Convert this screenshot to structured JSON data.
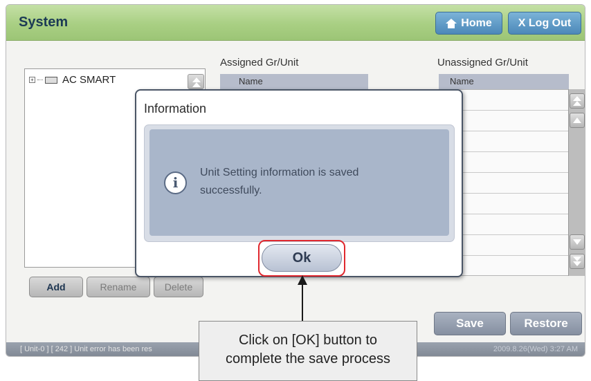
{
  "window": {
    "title": "System",
    "home_label": "Home",
    "logout_label": "X Log Out"
  },
  "tree": {
    "root_label": "AC SMART",
    "expand_symbol": "+"
  },
  "tree_buttons": {
    "add": "Add",
    "rename": "Rename",
    "delete": "Delete"
  },
  "assigned": {
    "title": "Assigned Gr/Unit",
    "column_header": "Name"
  },
  "unassigned": {
    "title": "Unassigned Gr/Unit",
    "column_header": "Name"
  },
  "actions": {
    "save": "Save",
    "restore": "Restore"
  },
  "statusbar": {
    "message": "[ Unit-0 ] [ 242 ] Unit error has been res",
    "datetime": "2009.8.26(Wed)  3:27 AM"
  },
  "dialog": {
    "title": "Information",
    "icon": "info-icon",
    "icon_glyph": "i",
    "message": "Unit Setting information is saved successfully.",
    "ok_label": "Ok"
  },
  "callout": {
    "line1": "Click on [OK] button to",
    "line2": "complete the save process"
  },
  "colors": {
    "titlebar": "#a9cf83",
    "highlight": "#e0282e",
    "dialog_panel": "#a9b6ca"
  }
}
